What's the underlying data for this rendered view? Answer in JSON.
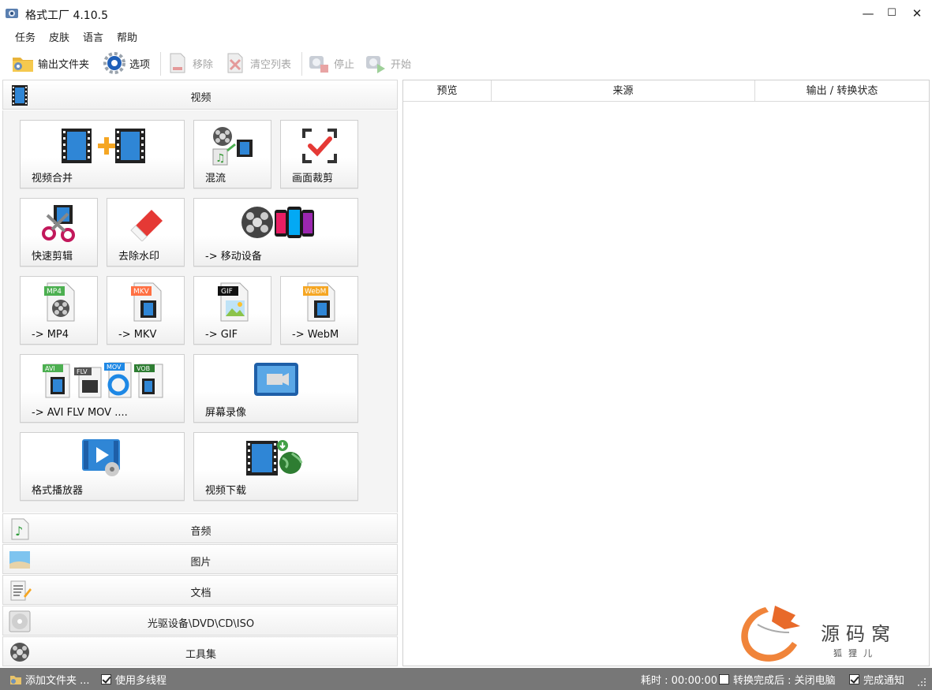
{
  "window": {
    "title": "格式工厂 4.10.5",
    "minimize": "—",
    "maximize": "☐",
    "close": "✕"
  },
  "menu": [
    "任务",
    "皮肤",
    "语言",
    "帮助"
  ],
  "toolbar": {
    "output_folder": "输出文件夹",
    "options": "选项",
    "remove": "移除",
    "clear_list": "清空列表",
    "stop": "停止",
    "start": "开始"
  },
  "categories": {
    "video": "视频",
    "audio": "音频",
    "image": "图片",
    "document": "文档",
    "disc": "光驱设备\\DVD\\CD\\ISO",
    "tools": "工具集"
  },
  "video_tiles": {
    "merge": "视频合并",
    "mux": "混流",
    "crop": "画面裁剪",
    "quick_cut": "快速剪辑",
    "remove_watermark": "去除水印",
    "mobile": "-> 移动设备",
    "mp4": "-> MP4",
    "mkv": "-> MKV",
    "gif": "-> GIF",
    "webm": "-> WebM",
    "avi_flv_mov": "-> AVI FLV MOV ....",
    "screen_record": "屏幕录像",
    "player": "格式播放器",
    "download": "视频下载"
  },
  "icon_badges": {
    "mp4": "MP4",
    "mkv": "MKV",
    "gif": "GIF",
    "webm": "WebM",
    "avi": "AVI",
    "flv": "FLV",
    "mov": "MOV",
    "vob": "VOB"
  },
  "table": {
    "columns": [
      "预览",
      "来源",
      "输出 / 转换状态"
    ]
  },
  "watermark": {
    "logo_text": "源码窝",
    "logo_sub": "狐狸儿"
  },
  "statusbar": {
    "add_folder": "添加文件夹 ...",
    "multithread": "使用多线程",
    "multithread_checked": true,
    "elapsed": "耗时 : 00:00:00",
    "shutdown_after": "转换完成后 : 关闭电脑",
    "shutdown_checked": false,
    "notify": "完成通知",
    "notify_checked": true
  },
  "colors": {
    "statusbar_bg": "#777777",
    "film_blue": "#2f86d6",
    "disabled_text": "#a6a6a6"
  }
}
